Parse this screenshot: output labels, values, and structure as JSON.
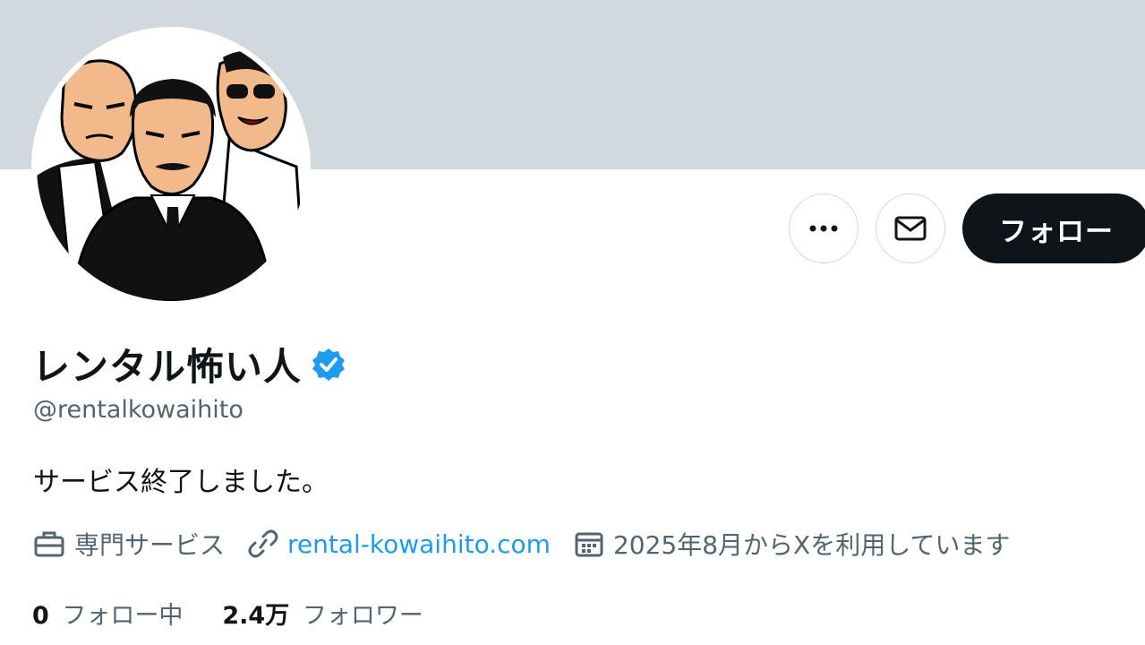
{
  "profile": {
    "display_name": "レンタル怖い人",
    "handle": "@rentalkowaihito",
    "bio": "サービス終了しました。",
    "category": "専門サービス",
    "website": "rental-kowaihito.com",
    "joined": "2025年8月からXを利用しています"
  },
  "actions": {
    "more_icon": "more-horizontal-icon",
    "message_icon": "envelope-icon",
    "follow_label": "フォロー"
  },
  "stats": {
    "following_count": "0",
    "following_label": "フォロー中",
    "followers_count": "2.4万",
    "followers_label": "フォロワー"
  },
  "colors": {
    "banner": "#cfd9de",
    "accent": "#1d9bf0",
    "text_primary": "#0f1419",
    "text_secondary": "#536471",
    "follow_button": "#0f1419"
  }
}
